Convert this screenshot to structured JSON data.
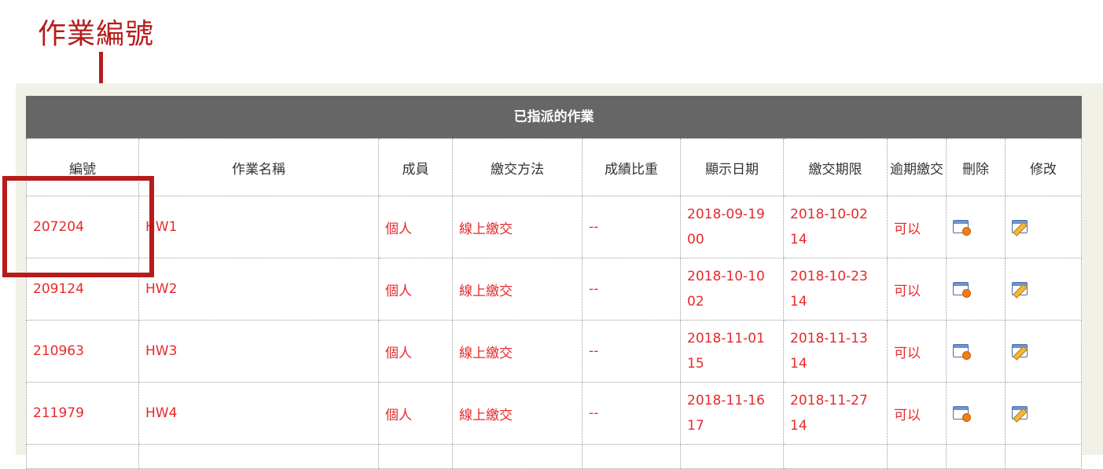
{
  "annotation": {
    "title": "作業編號"
  },
  "table": {
    "caption": "已指派的作業",
    "headers": [
      "編號",
      "作業名稱",
      "成員",
      "繳交方法",
      "成績比重",
      "顯示日期",
      "繳交期限",
      "逾期繳交",
      "刪除",
      "修改"
    ],
    "rows": [
      {
        "id": "207204",
        "name": "HW1",
        "member": "個人",
        "method": "線上繳交",
        "weight": "--",
        "show_date_a": "2018-09-19",
        "show_date_b": "00",
        "due_a": "2018-10-02",
        "due_b": "14",
        "late": "可以"
      },
      {
        "id": "209124",
        "name": "HW2",
        "member": "個人",
        "method": "線上繳交",
        "weight": "--",
        "show_date_a": "2018-10-10",
        "show_date_b": "02",
        "due_a": "2018-10-23",
        "due_b": "14",
        "late": "可以"
      },
      {
        "id": "210963",
        "name": "HW3",
        "member": "個人",
        "method": "線上繳交",
        "weight": "--",
        "show_date_a": "2018-11-01",
        "show_date_b": "15",
        "due_a": "2018-11-13",
        "due_b": "14",
        "late": "可以"
      },
      {
        "id": "211979",
        "name": "HW4",
        "member": "個人",
        "method": "線上繳交",
        "weight": "--",
        "show_date_a": "2018-11-16",
        "show_date_b": "17",
        "due_a": "2018-11-27",
        "due_b": "14",
        "late": "可以"
      }
    ]
  },
  "icons": {
    "delete": "delete-icon",
    "edit": "edit-icon"
  },
  "colors": {
    "header_bar": "#666666",
    "text_red": "#e8292c",
    "annotation": "#b71c1c",
    "panel": "#f1f1e7"
  }
}
